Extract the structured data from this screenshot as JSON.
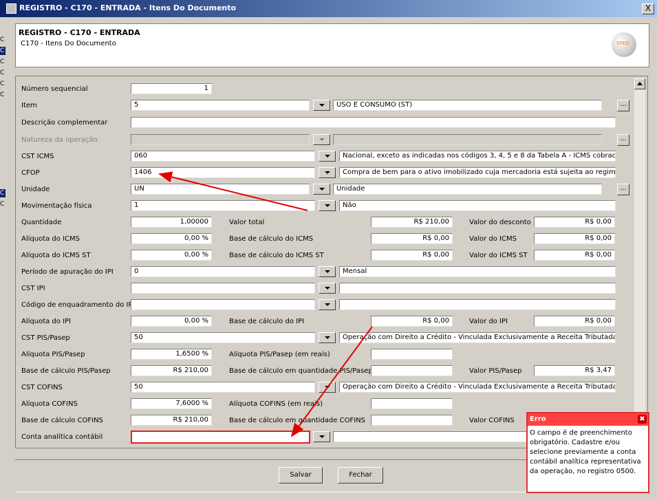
{
  "window": {
    "title": "REGISTRO - C170 - ENTRADA - Itens Do Documento",
    "close_label": "X"
  },
  "header": {
    "title": "REGISTRO - C170 - ENTRADA",
    "subtitle": "C170 - Itens Do Documento"
  },
  "left_strip": [
    "C",
    "C",
    "C",
    "C",
    "C",
    "C",
    "C",
    "C"
  ],
  "labels": {
    "numero_sequencial": "Número sequencial",
    "item": "Item",
    "descricao_complementar": "Descrição complementar",
    "natureza_operacao": "Natureza da operação",
    "cst_icms": "CST ICMS",
    "cfop": "CFOP",
    "unidade": "Unidade",
    "movimentacao_fisica": "Movimentação física",
    "quantidade": "Quantidade",
    "valor_total": "Valor total",
    "valor_desconto": "Valor do desconto",
    "aliquota_icms": "Alíquota do ICMS",
    "base_calculo_icms": "Base de cálculo do ICMS",
    "valor_icms": "Valor do ICMS",
    "aliquota_icms_st": "Alíquota do ICMS ST",
    "base_calculo_icms_st": "Base de cálculo do ICMS ST",
    "valor_icms_st": "Valor do ICMS ST",
    "periodo_apuracao_ipi": "Período de apuração do IPI",
    "cst_ipi": "CST IPI",
    "codigo_enquadramento_ipi": "Código de enquadramento do IPI",
    "aliquota_ipi": "Alíquota do IPI",
    "base_calculo_ipi": "Base de cálculo do IPI",
    "valor_ipi": "Valor do IPI",
    "cst_pis": "CST PIS/Pasep",
    "aliquota_pis": "Alíquota PIS/Pasep",
    "aliquota_pis_reais": "Alíquota PIS/Pasep (em reais)",
    "base_calculo_pis": "Base de cálculo PIS/Pasep",
    "base_calculo_qtd_pis": "Base de cálculo em quantidade PIS/Pasep",
    "valor_pis": "Valor PIS/Pasep",
    "cst_cofins": "CST COFINS",
    "aliquota_cofins": "Alíquota COFINS",
    "aliquota_cofins_reais": "Alíquota COFINS (em reais)",
    "base_calculo_cofins": "Base de cálculo COFINS",
    "base_calculo_qtd_cofins": "Base de cálculo em quantidade COFINS",
    "valor_cofins": "Valor COFINS",
    "conta_analitica": "Conta analítica contábil"
  },
  "values": {
    "numero_sequencial": "1",
    "item_code": "5",
    "item_desc": "USO E CONSUMO (ST)",
    "descricao_complementar": "",
    "natureza_code": "",
    "natureza_desc": "",
    "cst_icms_code": "060",
    "cst_icms_desc": "Nacional, exceto as indicadas nos códigos 3, 4, 5 e 8 da Tabela A - ICMS cobrado",
    "cfop_code": "1406",
    "cfop_desc": "Compra de bem para o ativo imobilizado cuja mercadoria está sujeita ao regime de",
    "unidade_code": "UN",
    "unidade_desc": "Unidade",
    "movimentacao_code": "1",
    "movimentacao_desc": "Não",
    "quantidade": "1,00000",
    "valor_total": "R$ 210,00",
    "valor_desconto": "R$ 0,00",
    "aliquota_icms": "0,00 %",
    "base_calculo_icms": "R$ 0,00",
    "valor_icms": "R$ 0,00",
    "aliquota_icms_st": "0,00 %",
    "base_calculo_icms_st": "R$ 0,00",
    "valor_icms_st": "R$ 0,00",
    "periodo_ipi_code": "0",
    "periodo_ipi_desc": "Mensal",
    "cst_ipi_code": "",
    "cst_ipi_desc": "",
    "codigo_enq_ipi_code": "",
    "codigo_enq_ipi_desc": "",
    "aliquota_ipi": "0,00 %",
    "base_calculo_ipi": "R$ 0,00",
    "valor_ipi": "R$ 0,00",
    "cst_pis_code": "50",
    "cst_pis_desc": "Operação com Direito a Crédito - Vinculada Exclusivamente a Receita Tributada no",
    "aliquota_pis": "1,6500 %",
    "aliquota_pis_reais": "",
    "base_calculo_pis": "R$ 210,00",
    "base_calculo_qtd_pis": "",
    "valor_pis": "R$ 3,47",
    "cst_cofins_code": "50",
    "cst_cofins_desc": "Operação com Direito a Crédito - Vinculada Exclusivamente a Receita Tributada no",
    "aliquota_cofins": "7,6000 %",
    "aliquota_cofins_reais": "",
    "base_calculo_cofins": "R$ 210,00",
    "base_calculo_qtd_cofins": "",
    "conta_analitica_code": "",
    "conta_analitica_desc": ""
  },
  "buttons": {
    "ellipsis": "...",
    "salvar": "Salvar",
    "fechar": "Fechar"
  },
  "error": {
    "title": "Erro",
    "close": "✖",
    "message": "O campo é de preenchimento obrigatório. Cadastre e/ou selecione previamente a conta contábil analítica representativa da operação, no registro 0500."
  },
  "colors": {
    "error_red": "#e02020",
    "title_bar": "#0a246a",
    "annotation_arrow": "#e00000"
  }
}
